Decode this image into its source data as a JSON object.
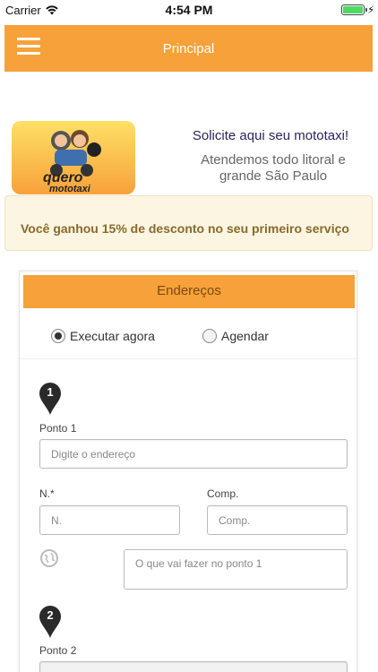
{
  "status_bar": {
    "carrier": "Carrier",
    "time": "4:54 PM"
  },
  "navbar": {
    "title": "Principal"
  },
  "promo": {
    "logo_text_line1": "quero",
    "logo_text_line2": "mototaxi",
    "headline": "Solicite aqui seu mototaxi!",
    "subline": "Atendemos todo litoral e grande São Paulo",
    "discount": "Você ganhou 15% de desconto no seu primeiro serviço"
  },
  "panel": {
    "title": "Endereços",
    "options": [
      {
        "label": "Executar agora",
        "selected": true
      },
      {
        "label": "Agendar",
        "selected": false
      }
    ]
  },
  "points": [
    {
      "number": "1",
      "label": "Ponto 1",
      "address_placeholder": "Digite o endereço",
      "number_label": "N.*",
      "number_placeholder": "N.",
      "comp_label": "Comp.",
      "comp_placeholder": "Comp.",
      "task_placeholder": "O que vai fazer no ponto 1"
    },
    {
      "number": "2",
      "label": "Ponto 2"
    }
  ],
  "colors": {
    "accent": "#f7a13a",
    "headline": "#2b2560",
    "discount_text": "#8a6a2b",
    "discount_bg": "#fbf5e2"
  }
}
